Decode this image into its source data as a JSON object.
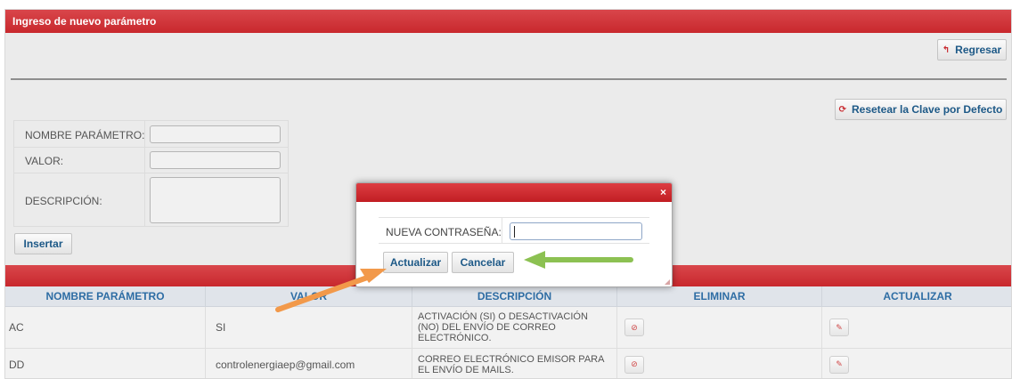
{
  "panel": {
    "title": "Ingreso de nuevo parámetro",
    "back_button": "Regresar",
    "reset_button": "Resetear la Clave por Defecto"
  },
  "form": {
    "name_label": "NOMBRE PARÁMETRO:",
    "value_label": "VALOR:",
    "desc_label": "DESCRIPCIÓN:",
    "insert_button": "Insertar"
  },
  "table": {
    "headers": [
      "NOMBRE PARÁMETRO",
      "VALOR",
      "DESCRIPCIÓN",
      "ELIMINAR",
      "ACTUALIZAR"
    ],
    "rows": [
      {
        "name": "AC",
        "value": "SI",
        "description": "ACTIVACIÓN (SI) O DESACTIVACIÓN (NO) DEL ENVÍO DE CORREO ELECTRÓNICO."
      },
      {
        "name": "DD",
        "value": "controlenergiaep@gmail.com",
        "description": "CORREO ELECTRÓNICO EMISOR PARA EL ENVÍO DE MAILS."
      }
    ]
  },
  "dialog": {
    "close_label": "×",
    "password_label": "NUEVA CONTRASEÑA:",
    "password_value": "",
    "update_button": "Actualizar",
    "cancel_button": "Cancelar"
  },
  "icons": {
    "back": "undo-arrow-icon",
    "reset": "refresh-icon",
    "delete": "delete-icon",
    "edit": "edit-icon"
  },
  "colors": {
    "header_red": "#c8282d",
    "link_blue": "#1d5987",
    "annotation_orange": "#f2994a",
    "annotation_green": "#8cc152"
  }
}
